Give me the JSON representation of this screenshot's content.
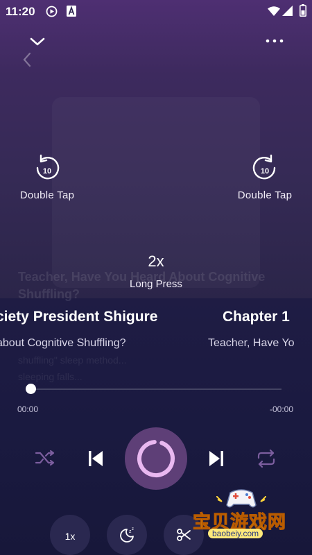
{
  "status_bar": {
    "time": "11:20",
    "icons": [
      "play-circle-icon",
      "font-a-icon",
      "wifi-icon",
      "signal-icon",
      "battery-icon"
    ]
  },
  "topbar": {
    "collapse_icon": "chevron-down-icon",
    "more_icon": "more-dots-icon",
    "back_icon": "chevron-left-icon"
  },
  "gestures": {
    "rewind_seconds": "10",
    "rewind_label": "Double Tap",
    "forward_seconds": "10",
    "forward_label": "Double Tap",
    "speed_value": "2x",
    "speed_label": "Long Press"
  },
  "background_text": {
    "title_line1": "Teacher, Have You Heard About Cognitive",
    "title_line2": "Shuffling?",
    "desc_line1": "shuffling\" sleep method...",
    "desc_line2": "sleeping  falls..."
  },
  "track": {
    "title_left": "ciety President Shigure",
    "title_right": "Chapter 1",
    "subtitle_left": "about Cognitive Shuffling?",
    "subtitle_right": "Teacher, Have Yo"
  },
  "progress": {
    "elapsed": "00:00",
    "remaining": "-00:00",
    "fraction": 0.0
  },
  "controls": {
    "shuffle_icon": "shuffle-icon",
    "previous_icon": "skip-previous-icon",
    "play_state_icon": "loading-ring-icon",
    "next_icon": "skip-next-icon",
    "repeat_icon": "repeat-icon"
  },
  "bottom_bar": {
    "speed_label": "1x",
    "sleep_icon": "sleep-timer-icon",
    "clip_icon": "scissors-icon"
  },
  "watermark": {
    "text": "宝贝游戏网",
    "url": "baobeiy.com"
  },
  "colors": {
    "accent_ring": "#e9b8f0",
    "play_button": "#5e3f77",
    "header_purple": "#4e2f72",
    "panel_navy": "#1a1a40"
  }
}
